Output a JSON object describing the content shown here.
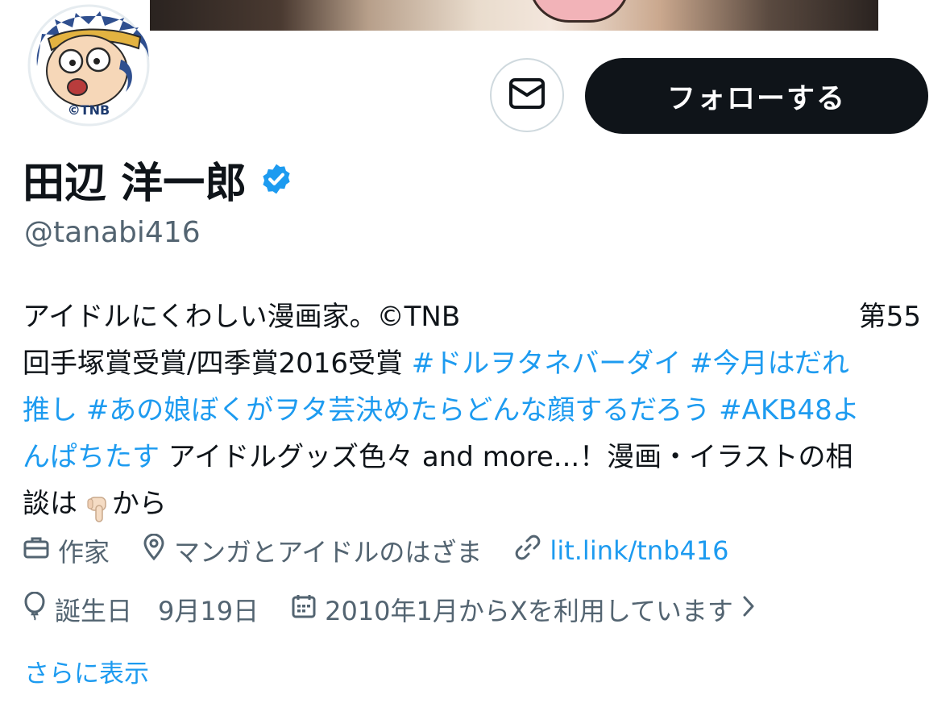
{
  "profile": {
    "name": "田辺 洋一郎",
    "handle": "@tanabi416",
    "follow_label": "フォローする",
    "avatar_label": "©TNB"
  },
  "bio": {
    "line1_text": "アイドルにくわしい漫画家。©TNB",
    "line1_right": "第55",
    "line2_text": "回手塚賞受賞/四季賞2016受賞 ",
    "line2_tag1": "#ドルヲタネバーダイ",
    "line2_tag2": "#今月はだれ",
    "line3_tag2_cont": "推し",
    "line3_tag3": "#あの娘ぼくがヲタ芸決めたらどんな顔するだろう",
    "line3_tag4": "#AKB48よ",
    "line4_tag4_cont": "んぱちたす",
    "line4_text": " アイドルグッズ色々 and more...！漫画・イラストの相",
    "line5_text_a": "談は ",
    "line5_text_b": "から"
  },
  "meta": {
    "job": "作家",
    "location": "マンガとアイドルのはざま",
    "link": "lit.link/tnb416",
    "birthday": "誕生日　9月19日",
    "joined": "2010年1月からXを利用しています"
  },
  "show_more": "さらに表示",
  "colors": {
    "accent": "#1d9bf0",
    "secondary_text": "#536471",
    "button_dark": "#0f1419",
    "verified": "#1d9bf0"
  },
  "icons": {
    "message": "envelope-icon",
    "verified": "verified-badge-icon",
    "job": "briefcase-icon",
    "location": "map-pin-icon",
    "link": "link-icon",
    "birthday": "balloon-icon",
    "joined": "calendar-icon",
    "chevron": "chevron-right-icon",
    "hand": "pointing-down-emoji"
  }
}
